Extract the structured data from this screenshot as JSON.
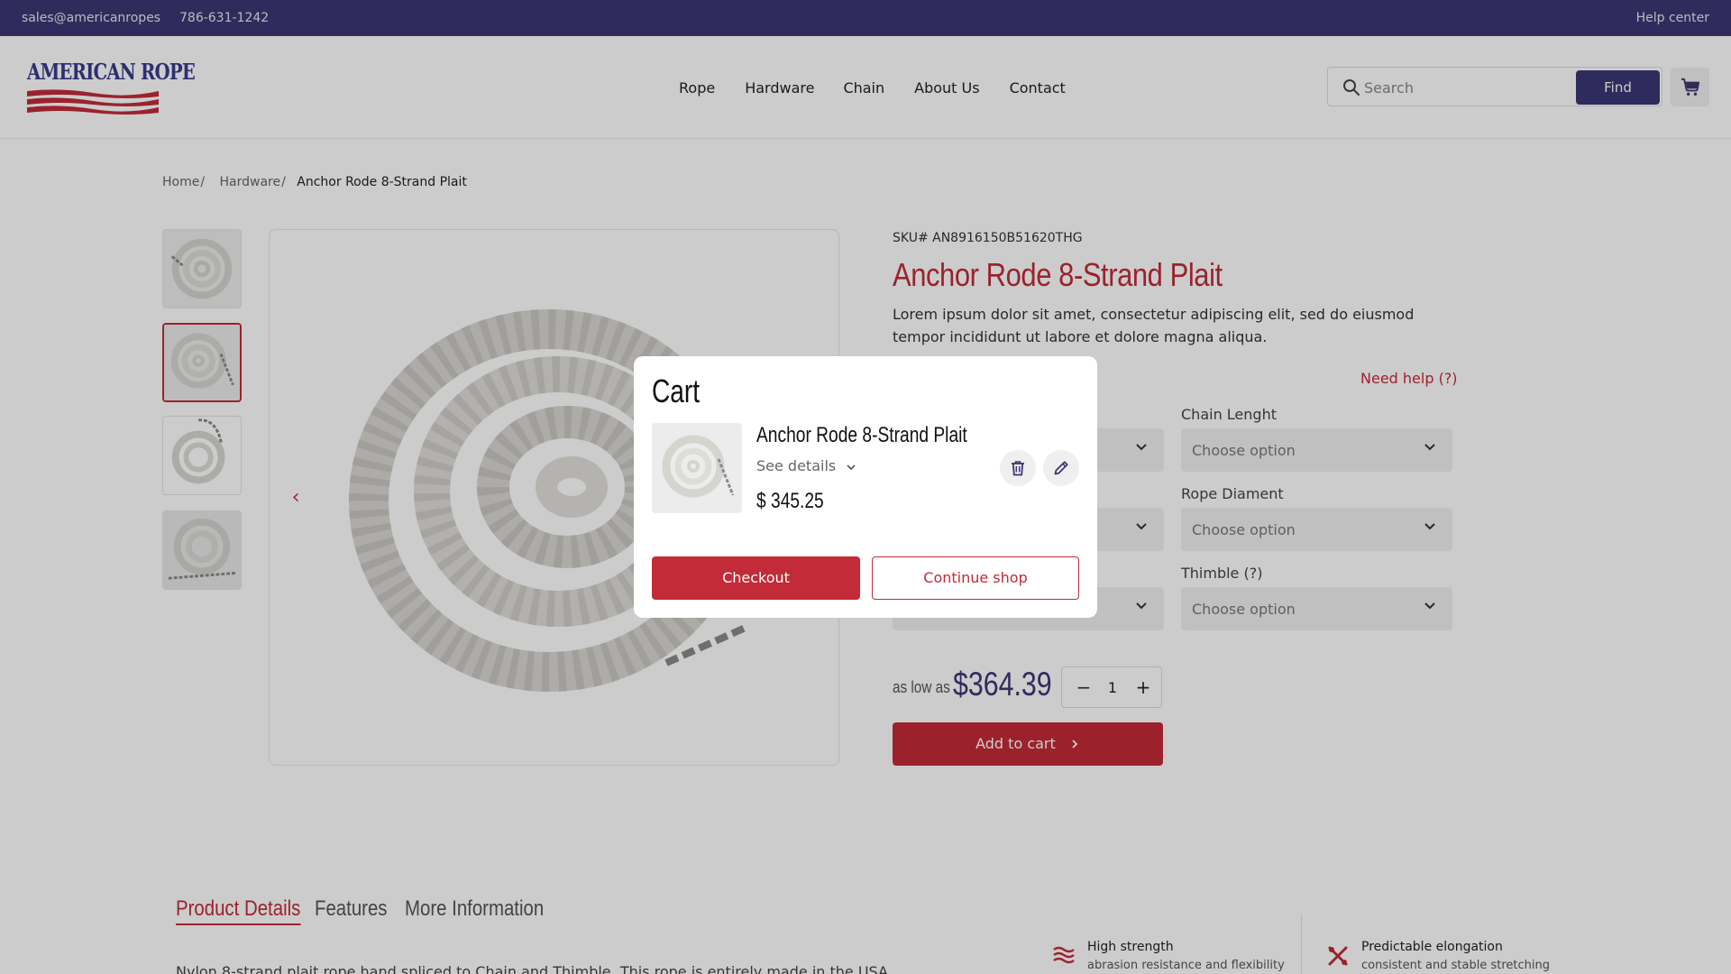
{
  "topbar": {
    "email": "sales@americanropes",
    "phone": "786-631-1242",
    "help": "Help center"
  },
  "header": {
    "logo_text": "AMERICAN ROPE",
    "nav": [
      "Rope",
      "Hardware",
      "Chain",
      "About Us",
      "Contact"
    ],
    "search_placeholder": "Search",
    "find_label": "Find"
  },
  "breadcrumb": {
    "home": "Home",
    "hardware": "Hardware",
    "sep": "/",
    "current": "Anchor Rode 8-Strand Plait"
  },
  "product": {
    "sku": "SKU# AN8916150B51620THG",
    "title": "Anchor Rode 8-Strand Plait",
    "description": "Lorem ipsum dolor sit amet, consectetur adipiscing elit, sed do eiusmod tempor incididunt ut labore et dolore magna aliqua.",
    "need_help": "Need help (?)",
    "options": [
      {
        "label": "Chain Lenght",
        "value": "Choose option"
      },
      {
        "label": "Rope Diament",
        "value": "Choose option"
      },
      {
        "label": "Thimble (?)",
        "value": "Choose option"
      }
    ],
    "price_prefix": "as low as",
    "price": "$364.39",
    "quantity": "1",
    "qty_minus": "−",
    "qty_plus": "+",
    "add_to_cart": "Add to cart",
    "prev_arrow": "‹"
  },
  "tabs": [
    "Product Details",
    "Features",
    "More Information"
  ],
  "details_text": "Nylon 8-strand plait rope hand spliced to Chain and Thimble. This rope is entirely made in the USA.",
  "features": [
    {
      "title": "High strength",
      "subtitle": "abrasion resistance and flexibility",
      "icon": "waves-icon"
    },
    {
      "title": "Predictable elongation",
      "subtitle": "consistent and stable stretching",
      "icon": "tools-icon"
    }
  ],
  "cart_modal": {
    "title": "Cart",
    "item_name": "Anchor Rode 8-Strand Plait",
    "see_details": "See details",
    "item_price": "$ 345.25",
    "checkout": "Checkout",
    "continue": "Continue shop"
  },
  "colors": {
    "brand_navy": "#3c3675",
    "brand_red": "#c22b37"
  }
}
